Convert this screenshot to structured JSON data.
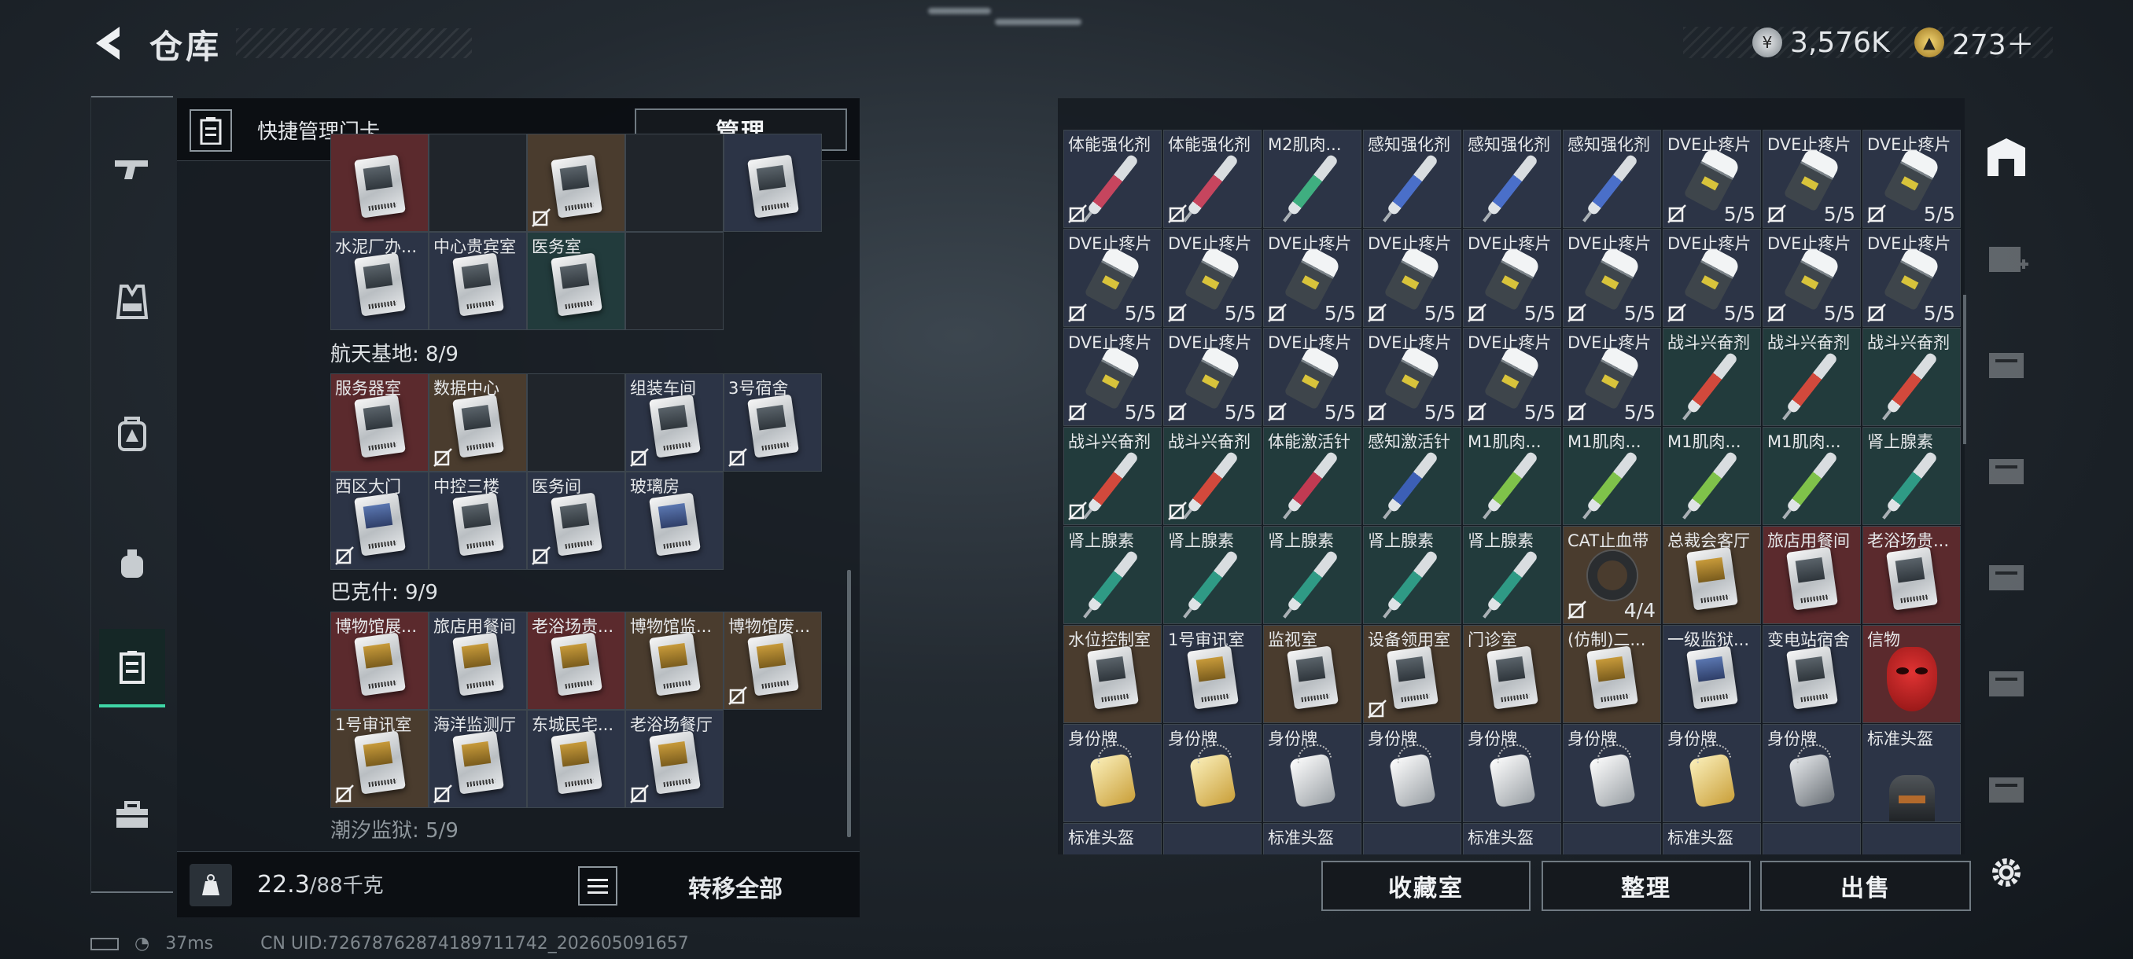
{
  "header": {
    "title": "仓库",
    "currency1": "3,576K",
    "currency2": "273＋"
  },
  "left": {
    "quick_label": "快捷管理门卡",
    "manage": "管理",
    "weight_value": "22.3",
    "weight_total": "/88千克",
    "transfer": "转移全部",
    "sections": [
      {
        "name": "航天基地: 8/9"
      },
      {
        "name": "巴克什: 9/9"
      },
      {
        "name": "潮汐监狱: 5/9"
      }
    ],
    "group0": [
      "",
      "",
      "",
      "",
      "",
      "水泥厂办...",
      "中心贵宾室",
      "医务室"
    ],
    "group1": [
      "服务器室",
      "数据中心",
      "",
      "组装车间",
      "3号宿舍",
      "西区大门",
      "中控三楼",
      "医务间",
      "玻璃房"
    ],
    "group2": [
      "博物馆展...",
      "旅店用餐间",
      "老浴场贵...",
      "博物馆监...",
      "博物馆废...",
      "1号审讯室",
      "海洋监测厅",
      "东城民宅...",
      "老浴场餐厅"
    ]
  },
  "right": {
    "items": [
      [
        "体能强化剂",
        "体能强化剂",
        "M2肌肉...",
        "感知强化剂",
        "感知强化剂",
        "感知强化剂",
        "DVE止疼片",
        "DVE止疼片",
        "DVE止疼片"
      ],
      [
        "DVE止疼片",
        "DVE止疼片",
        "DVE止疼片",
        "DVE止疼片",
        "DVE止疼片",
        "DVE止疼片",
        "DVE止疼片",
        "DVE止疼片",
        "DVE止疼片"
      ],
      [
        "DVE止疼片",
        "DVE止疼片",
        "DVE止疼片",
        "DVE止疼片",
        "DVE止疼片",
        "DVE止疼片",
        "战斗兴奋剂",
        "战斗兴奋剂",
        "战斗兴奋剂"
      ],
      [
        "战斗兴奋剂",
        "战斗兴奋剂",
        "体能激活针",
        "感知激活针",
        "M1肌肉...",
        "M1肌肉...",
        "M1肌肉...",
        "M1肌肉...",
        "肾上腺素"
      ],
      [
        "肾上腺素",
        "肾上腺素",
        "肾上腺素",
        "肾上腺素",
        "肾上腺素",
        "CAT止血带",
        "总裁会客厅",
        "旅店用餐间",
        "老浴场贵..."
      ],
      [
        "水位控制室",
        "1号审讯室",
        "监视室",
        "设备领用室",
        "门诊室",
        "(仿制)二...",
        "一级监狱...",
        "变电站宿舍",
        "信物"
      ],
      [
        "身份牌",
        "身份牌",
        "身份牌",
        "身份牌",
        "身份牌",
        "身份牌",
        "身份牌",
        "身份牌",
        "标准头盔"
      ],
      [
        "标准头盔",
        "",
        "标准头盔",
        "",
        "标准头盔",
        "",
        "标准头盔",
        "",
        ""
      ]
    ],
    "count55": "5/5",
    "count44": "4/4",
    "btn_collection": "收藏室",
    "btn_sort": "整理",
    "btn_sell": "出售"
  },
  "status": {
    "ping": "37ms",
    "uid": "CN UID:7267876287418971174​2_202605091657"
  },
  "colors": {
    "accent": "#3fd6a6",
    "red_slot": "#5b2a2d",
    "gold_slot": "#4a3c2e",
    "blue_slot": "#2c3446",
    "green_slot": "#223b3c"
  }
}
